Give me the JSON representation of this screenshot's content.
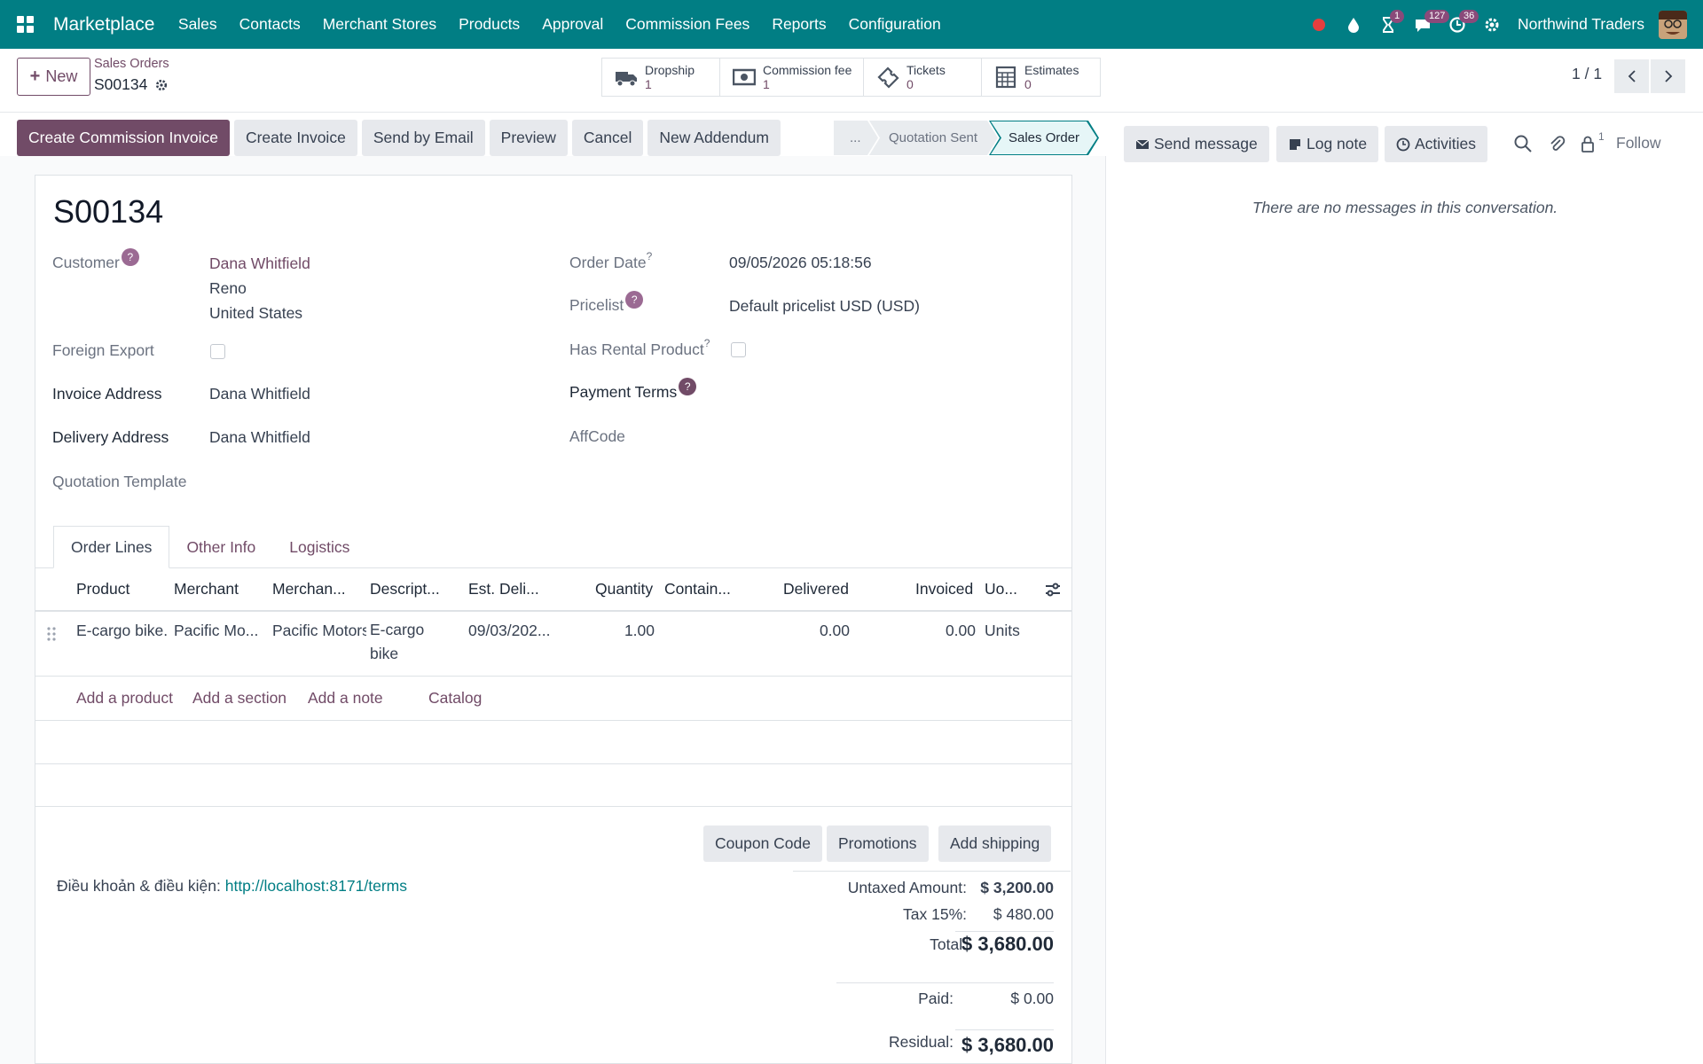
{
  "navbar": {
    "brand": "Marketplace",
    "menu": [
      "Sales",
      "Contacts",
      "Merchant Stores",
      "Products",
      "Approval",
      "Commission Fees",
      "Reports",
      "Configuration"
    ],
    "activity_badge": "1",
    "messages_badge": "127",
    "clock_badge": "36",
    "company": "Northwind Traders"
  },
  "control_panel": {
    "new_label": "New",
    "breadcrumb": "Sales Orders",
    "record": "S00134",
    "smart_buttons": [
      {
        "label": "Dropship",
        "value": "1",
        "icon": "truck-icon"
      },
      {
        "label": "Commission fee",
        "value": "1",
        "icon": "money-icon"
      },
      {
        "label": "Tickets",
        "value": "0",
        "icon": "ticket-icon"
      },
      {
        "label": "Estimates",
        "value": "0",
        "icon": "calculator-icon"
      }
    ],
    "pager": "1 / 1"
  },
  "actions": [
    "Create Commission Invoice",
    "Create Invoice",
    "Send by Email",
    "Preview",
    "Cancel",
    "New Addendum"
  ],
  "status_stages": [
    "...",
    "Quotation Sent",
    "Sales Order"
  ],
  "form": {
    "title": "S00134",
    "customer_label": "Customer",
    "customer_name": "Dana Whitfield",
    "customer_city": "Reno",
    "customer_country": "United States",
    "foreign_export_label": "Foreign Export",
    "invoice_address_label": "Invoice Address",
    "invoice_address": "Dana Whitfield",
    "delivery_address_label": "Delivery Address",
    "delivery_address": "Dana Whitfield",
    "quotation_template_label": "Quotation Template",
    "order_date_label": "Order Date",
    "order_date": "09/05/2026 05:18:56",
    "pricelist_label": "Pricelist",
    "pricelist": "Default pricelist USD (USD)",
    "rental_label": "Has Rental Product",
    "payment_terms_label": "Payment Terms",
    "affcode_label": "AffCode"
  },
  "tabs": [
    "Order Lines",
    "Other Info",
    "Logistics"
  ],
  "order_lines": {
    "columns": [
      "Product",
      "Merchant",
      "Merchan...",
      "Descript...",
      "Est. Deli...",
      "Quantity",
      "Contain...",
      "Delivered",
      "Invoiced",
      "Uo..."
    ],
    "rows": [
      {
        "product": "E-cargo bike.",
        "merchant": "Pacific Mo...",
        "merchant_store": "Pacific Motors",
        "description_1": "E-cargo",
        "description_2": "bike",
        "est_delivery": "09/03/202...",
        "quantity": "1.00",
        "delivered": "0.00",
        "invoiced": "0.00",
        "uom": "Units"
      }
    ],
    "add_links": [
      "Add a product",
      "Add a section",
      "Add a note",
      "Catalog"
    ]
  },
  "promo_buttons": [
    "Coupon Code",
    "Promotions",
    "Add shipping"
  ],
  "terms": {
    "label": "Điều khoản & điều kiện:",
    "link": "http://localhost:8171/terms"
  },
  "totals": {
    "untaxed_label": "Untaxed Amount:",
    "untaxed": "$ 3,200.00",
    "tax_label": "Tax 15%:",
    "tax": "$ 480.00",
    "total_label": "Total:",
    "total": "$ 3,680.00",
    "paid_label": "Paid:",
    "paid": "$ 0.00",
    "residual_label": "Residual:",
    "residual": "$ 3,680.00"
  },
  "chatter": {
    "send_message": "Send message",
    "log_note": "Log note",
    "activities": "Activities",
    "followers_count": "1",
    "follow": "Follow",
    "empty": "There are no messages in this conversation."
  },
  "colors": {
    "navbar": "#017e84",
    "primary": "#714b67",
    "link": "#017e84"
  }
}
